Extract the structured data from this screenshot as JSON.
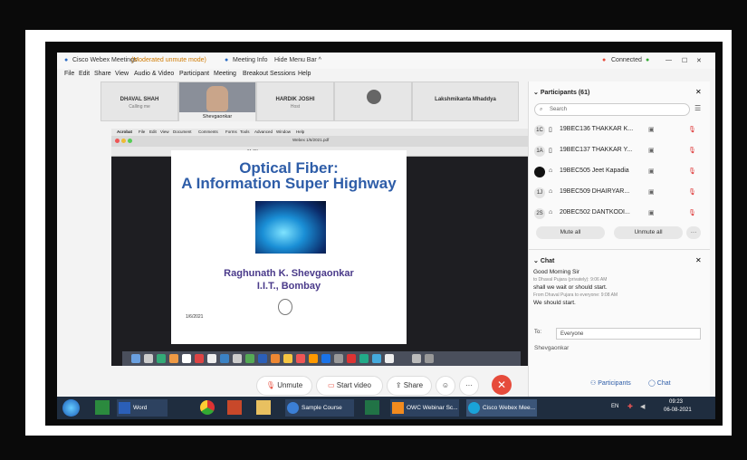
{
  "window": {
    "title": "Cisco Webex Meetings",
    "mode": "(Moderated unmute mode)",
    "meeting_info": "Meeting Info",
    "hide_menu_bar": "Hide Menu Bar ^",
    "connection_status": "Connected",
    "min_glyph": "—",
    "max_glyph": "☐",
    "close_glyph": "✕"
  },
  "menu": [
    "File",
    "Edit",
    "Share",
    "View",
    "Audio & Video",
    "Participant",
    "Meeting",
    "Breakout Sessions",
    "Help"
  ],
  "thumbnails": [
    {
      "name": "DHAVAL SHAH",
      "status": "Calling me"
    },
    {
      "name": "Shevgaonkar",
      "status": ""
    },
    {
      "name": "HARDIK JOSHI",
      "status": "Host"
    },
    {
      "name": "",
      "status": ""
    },
    {
      "name": "Lakshmikanta Mhaddya",
      "status": ""
    }
  ],
  "shared_screen": {
    "mac_menu": [
      "Acrobat",
      "File",
      "Edit",
      "View",
      "Document",
      "Comments",
      "Forms",
      "Tools",
      "Advanced",
      "Window",
      "Help"
    ],
    "doc_title": "Webex 1/6/2021.pdf",
    "zoom": "61.3%",
    "slide": {
      "title_line1": "Optical Fiber:",
      "title_line2": "A Information Super Highway",
      "author": "Raghunath K. Shevgaonkar",
      "institution": "I.I.T., Bombay",
      "date": "1/6/2021"
    }
  },
  "controls": {
    "unmute": "Unmute",
    "start_video": "Start video",
    "share": "Share",
    "more": "···",
    "end": "✕"
  },
  "participants_panel": {
    "header": "Participants (61)",
    "search_placeholder": "Search",
    "rows": [
      {
        "initials": "1C",
        "name": "19BEC136 THAKKAR K..."
      },
      {
        "initials": "1A",
        "name": "19BEC137 THAKKAR Y..."
      },
      {
        "initials": "",
        "name": "19BEC505 Jeet Kapadia"
      },
      {
        "initials": "1J",
        "name": "19BEC509 DHAIRYAR..."
      },
      {
        "initials": "2S",
        "name": "20BEC502 DANTKODI..."
      }
    ],
    "mute_all": "Mute all",
    "unmute_all": "Unmute all"
  },
  "chat_panel": {
    "header": "Chat",
    "messages": [
      {
        "text": "Good Morning Sir",
        "meta": "to Dhaval Pujara (privately): 9:06 AM"
      },
      {
        "text": "shall we wait or should start.",
        "meta": "From Dhaval Pujara to everyone: 9:08 AM"
      },
      {
        "text": "We should start.",
        "meta": ""
      }
    ],
    "to_label": "To:",
    "to_value": "Everyone",
    "draft": "Shevgaonkar"
  },
  "bottom_tabs": {
    "participants": "Participants",
    "chat": "Chat"
  },
  "taskbar": {
    "items": [
      "Word",
      "Sample Course Fil...",
      "OWC Webinar Sc...",
      "Cisco Webex Mee..."
    ],
    "lang": "EN",
    "time": "09:23",
    "date": "06-08-2021"
  },
  "colors": {
    "accent": "#2e5da8",
    "end_call": "#e64b3b",
    "taskbar": "#1f2d3f"
  }
}
